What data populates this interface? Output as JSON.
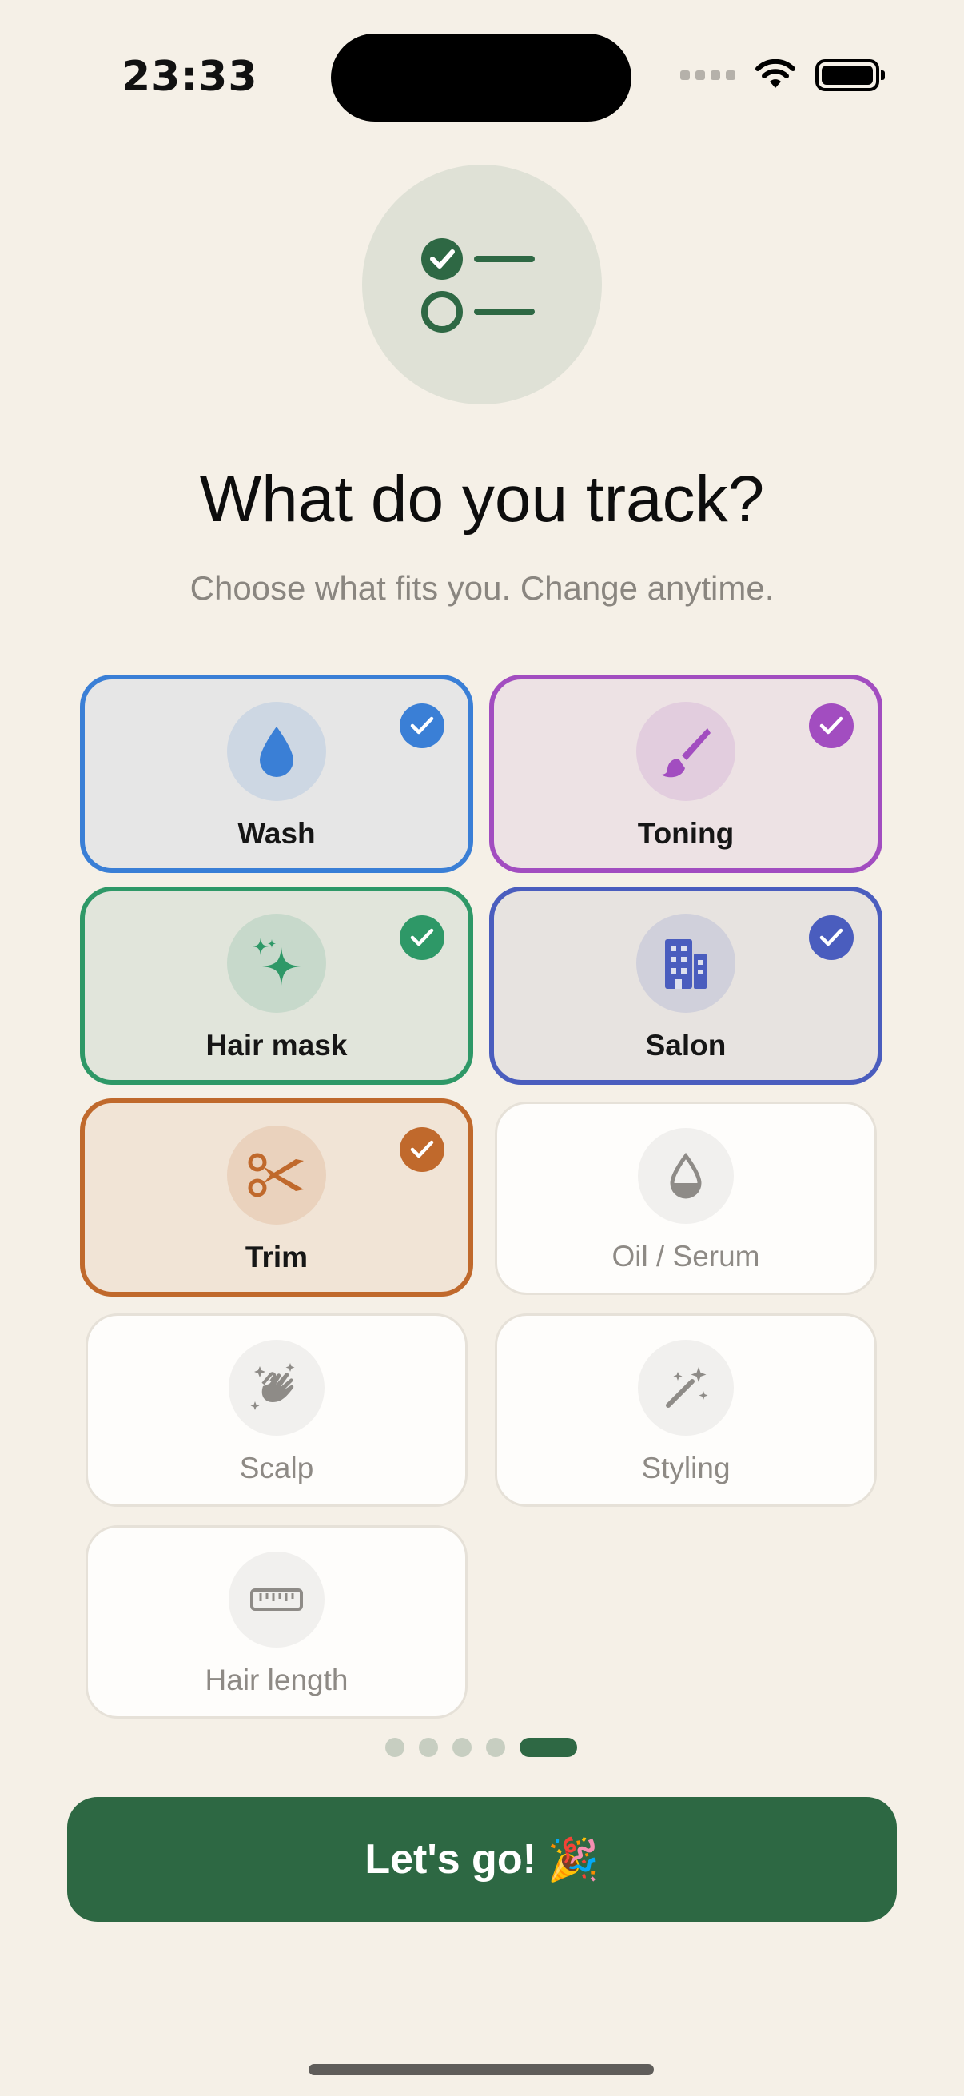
{
  "status_bar": {
    "time": "23:33"
  },
  "header": {
    "title": "What do you track?",
    "subtitle": "Choose what fits you. Change anytime."
  },
  "options": [
    {
      "label": "Wash",
      "selected": true,
      "color": "#3A7FD6",
      "bg": "#E6E6E6",
      "icon": "water-drop-icon"
    },
    {
      "label": "Toning",
      "selected": true,
      "color": "#A24DC0",
      "bg": "#EDE2E4",
      "icon": "paintbrush-icon"
    },
    {
      "label": "Hair mask",
      "selected": true,
      "color": "#2E9867",
      "bg": "#E1E5DB",
      "icon": "sparkles-icon"
    },
    {
      "label": "Salon",
      "selected": true,
      "color": "#4A5DBE",
      "bg": "#E7E3E0",
      "icon": "building-icon"
    },
    {
      "label": "Trim",
      "selected": true,
      "color": "#C0692C",
      "bg": "#F1E4D6",
      "icon": "scissors-icon"
    },
    {
      "label": "Oil / Serum",
      "selected": false,
      "icon": "oil-drop-icon"
    },
    {
      "label": "Scalp",
      "selected": false,
      "icon": "hands-sparkle-icon"
    },
    {
      "label": "Styling",
      "selected": false,
      "icon": "magic-wand-icon"
    },
    {
      "label": "Hair length",
      "selected": false,
      "icon": "ruler-icon"
    }
  ],
  "pager": {
    "count": 5,
    "active": 5
  },
  "cta": {
    "label": "Let's go!",
    "emoji": "🎉"
  },
  "colors": {
    "accent": "#2D6843",
    "background": "#F5F0E7"
  }
}
